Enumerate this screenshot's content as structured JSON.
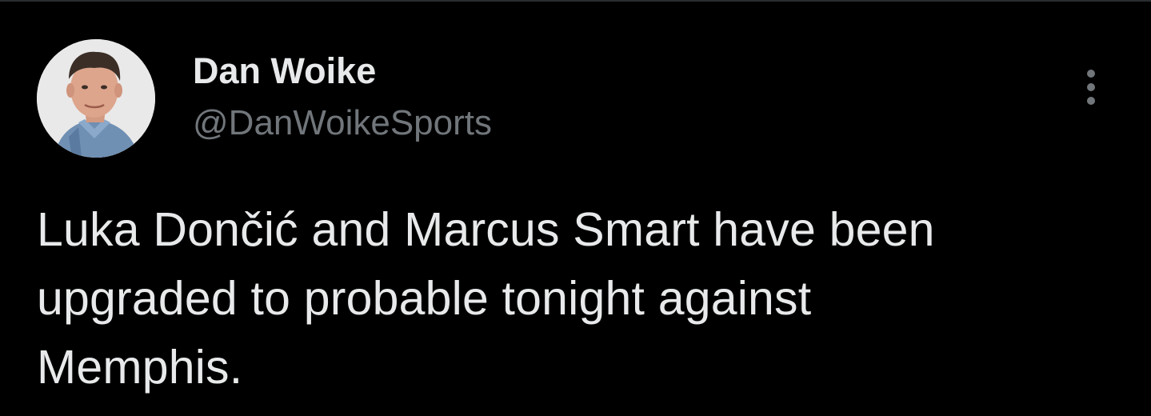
{
  "tweet": {
    "author": {
      "display_name": "Dan Woike",
      "handle": "@DanWoikeSports",
      "avatar": "profile-photo"
    },
    "more_icon": "more-vertical-icon",
    "text": "Luka Dončić and Marcus Smart have been\nupgraded to probable tonight against\nMemphis.",
    "colors": {
      "background": "#000000",
      "primary_text": "#e7e9ea",
      "secondary_text": "#71767b"
    }
  }
}
